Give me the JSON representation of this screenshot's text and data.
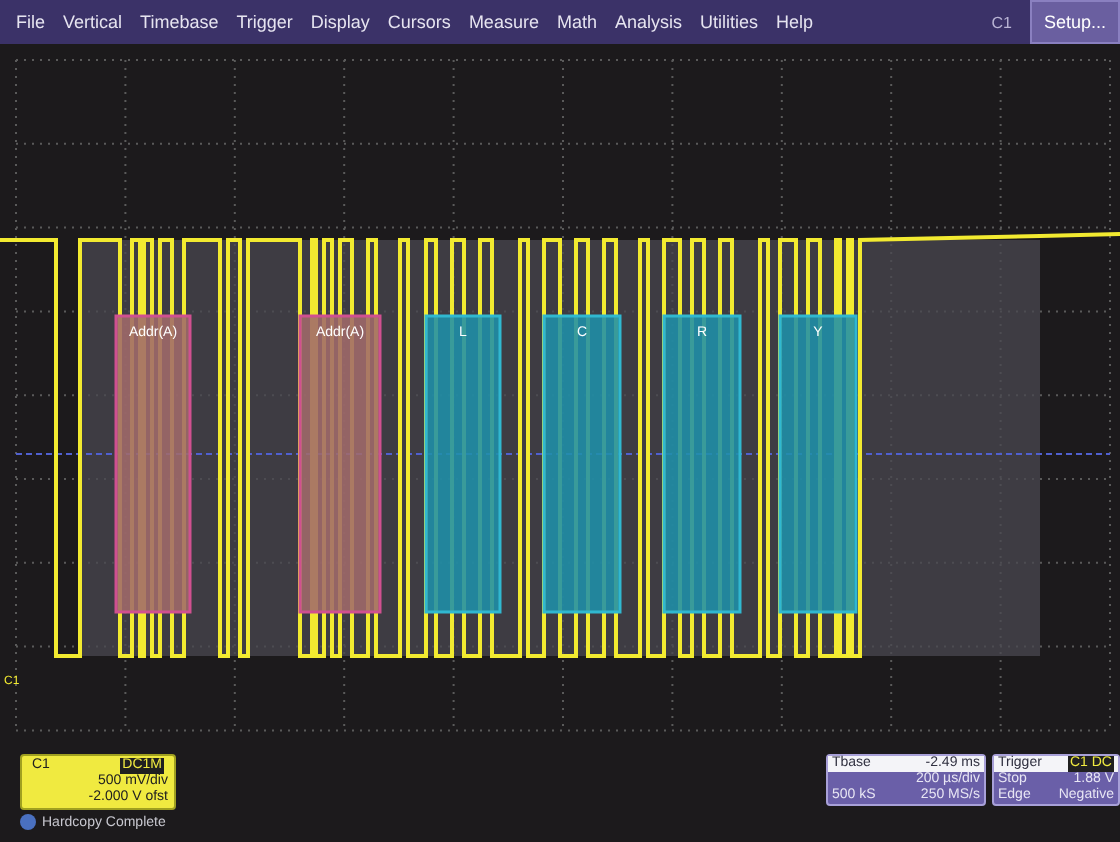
{
  "menu": {
    "items": [
      "File",
      "Vertical",
      "Timebase",
      "Trigger",
      "Display",
      "Cursors",
      "Measure",
      "Math",
      "Analysis",
      "Utilities",
      "Help"
    ],
    "channel": "C1",
    "setup_button": "Setup..."
  },
  "screen": {
    "ground_marker": "C1",
    "packets": [
      {
        "label": "Addr(A)",
        "kind": "address"
      },
      {
        "label": "Addr(A)",
        "kind": "address"
      },
      {
        "label": "L",
        "kind": "data"
      },
      {
        "label": "C",
        "kind": "data"
      },
      {
        "label": "R",
        "kind": "data"
      },
      {
        "label": "Y",
        "kind": "data"
      }
    ]
  },
  "channel_box": {
    "name": "C1",
    "coupling": "DC1M",
    "scale": "500 mV/div",
    "offset": "-2.000 V ofst"
  },
  "timebase_box": {
    "title": "Tbase",
    "delay": "-2.49 ms",
    "scale": "200 µs/div",
    "samples": "500 kS",
    "rate": "250 MS/s"
  },
  "trigger_box": {
    "title": "Trigger",
    "source": "C1 DC",
    "mode": "Stop",
    "level": "1.88 V",
    "type": "Edge",
    "slope": "Negative"
  },
  "status": "Hardcopy Complete"
}
